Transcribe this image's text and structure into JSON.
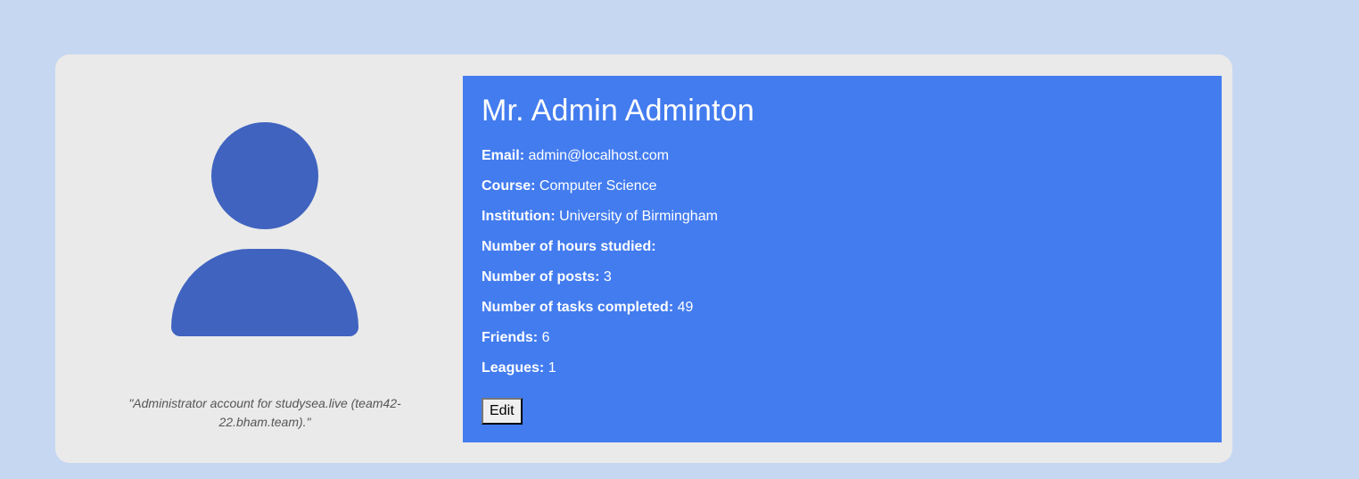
{
  "profile": {
    "name": "Mr. Admin Adminton",
    "bio": "\"Administrator account for studysea.live (team42-22.bham.team).\"",
    "fields": [
      {
        "label": "Email:",
        "value": "admin@localhost.com"
      },
      {
        "label": "Course:",
        "value": "Computer Science"
      },
      {
        "label": "Institution:",
        "value": "University of Birmingham"
      },
      {
        "label": "Number of hours studied:",
        "value": ""
      },
      {
        "label": "Number of posts:",
        "value": "3"
      },
      {
        "label": "Number of tasks completed:",
        "value": "49"
      },
      {
        "label": "Friends:",
        "value": "6"
      },
      {
        "label": "Leagues:",
        "value": "1"
      }
    ],
    "edit_label": "Edit"
  },
  "colors": {
    "page_background": "#c6d7f1",
    "card_background": "#eaeaea",
    "info_panel": "#437cef",
    "avatar": "#3f63bf"
  },
  "icons": {
    "avatar": "user-silhouette-icon"
  }
}
